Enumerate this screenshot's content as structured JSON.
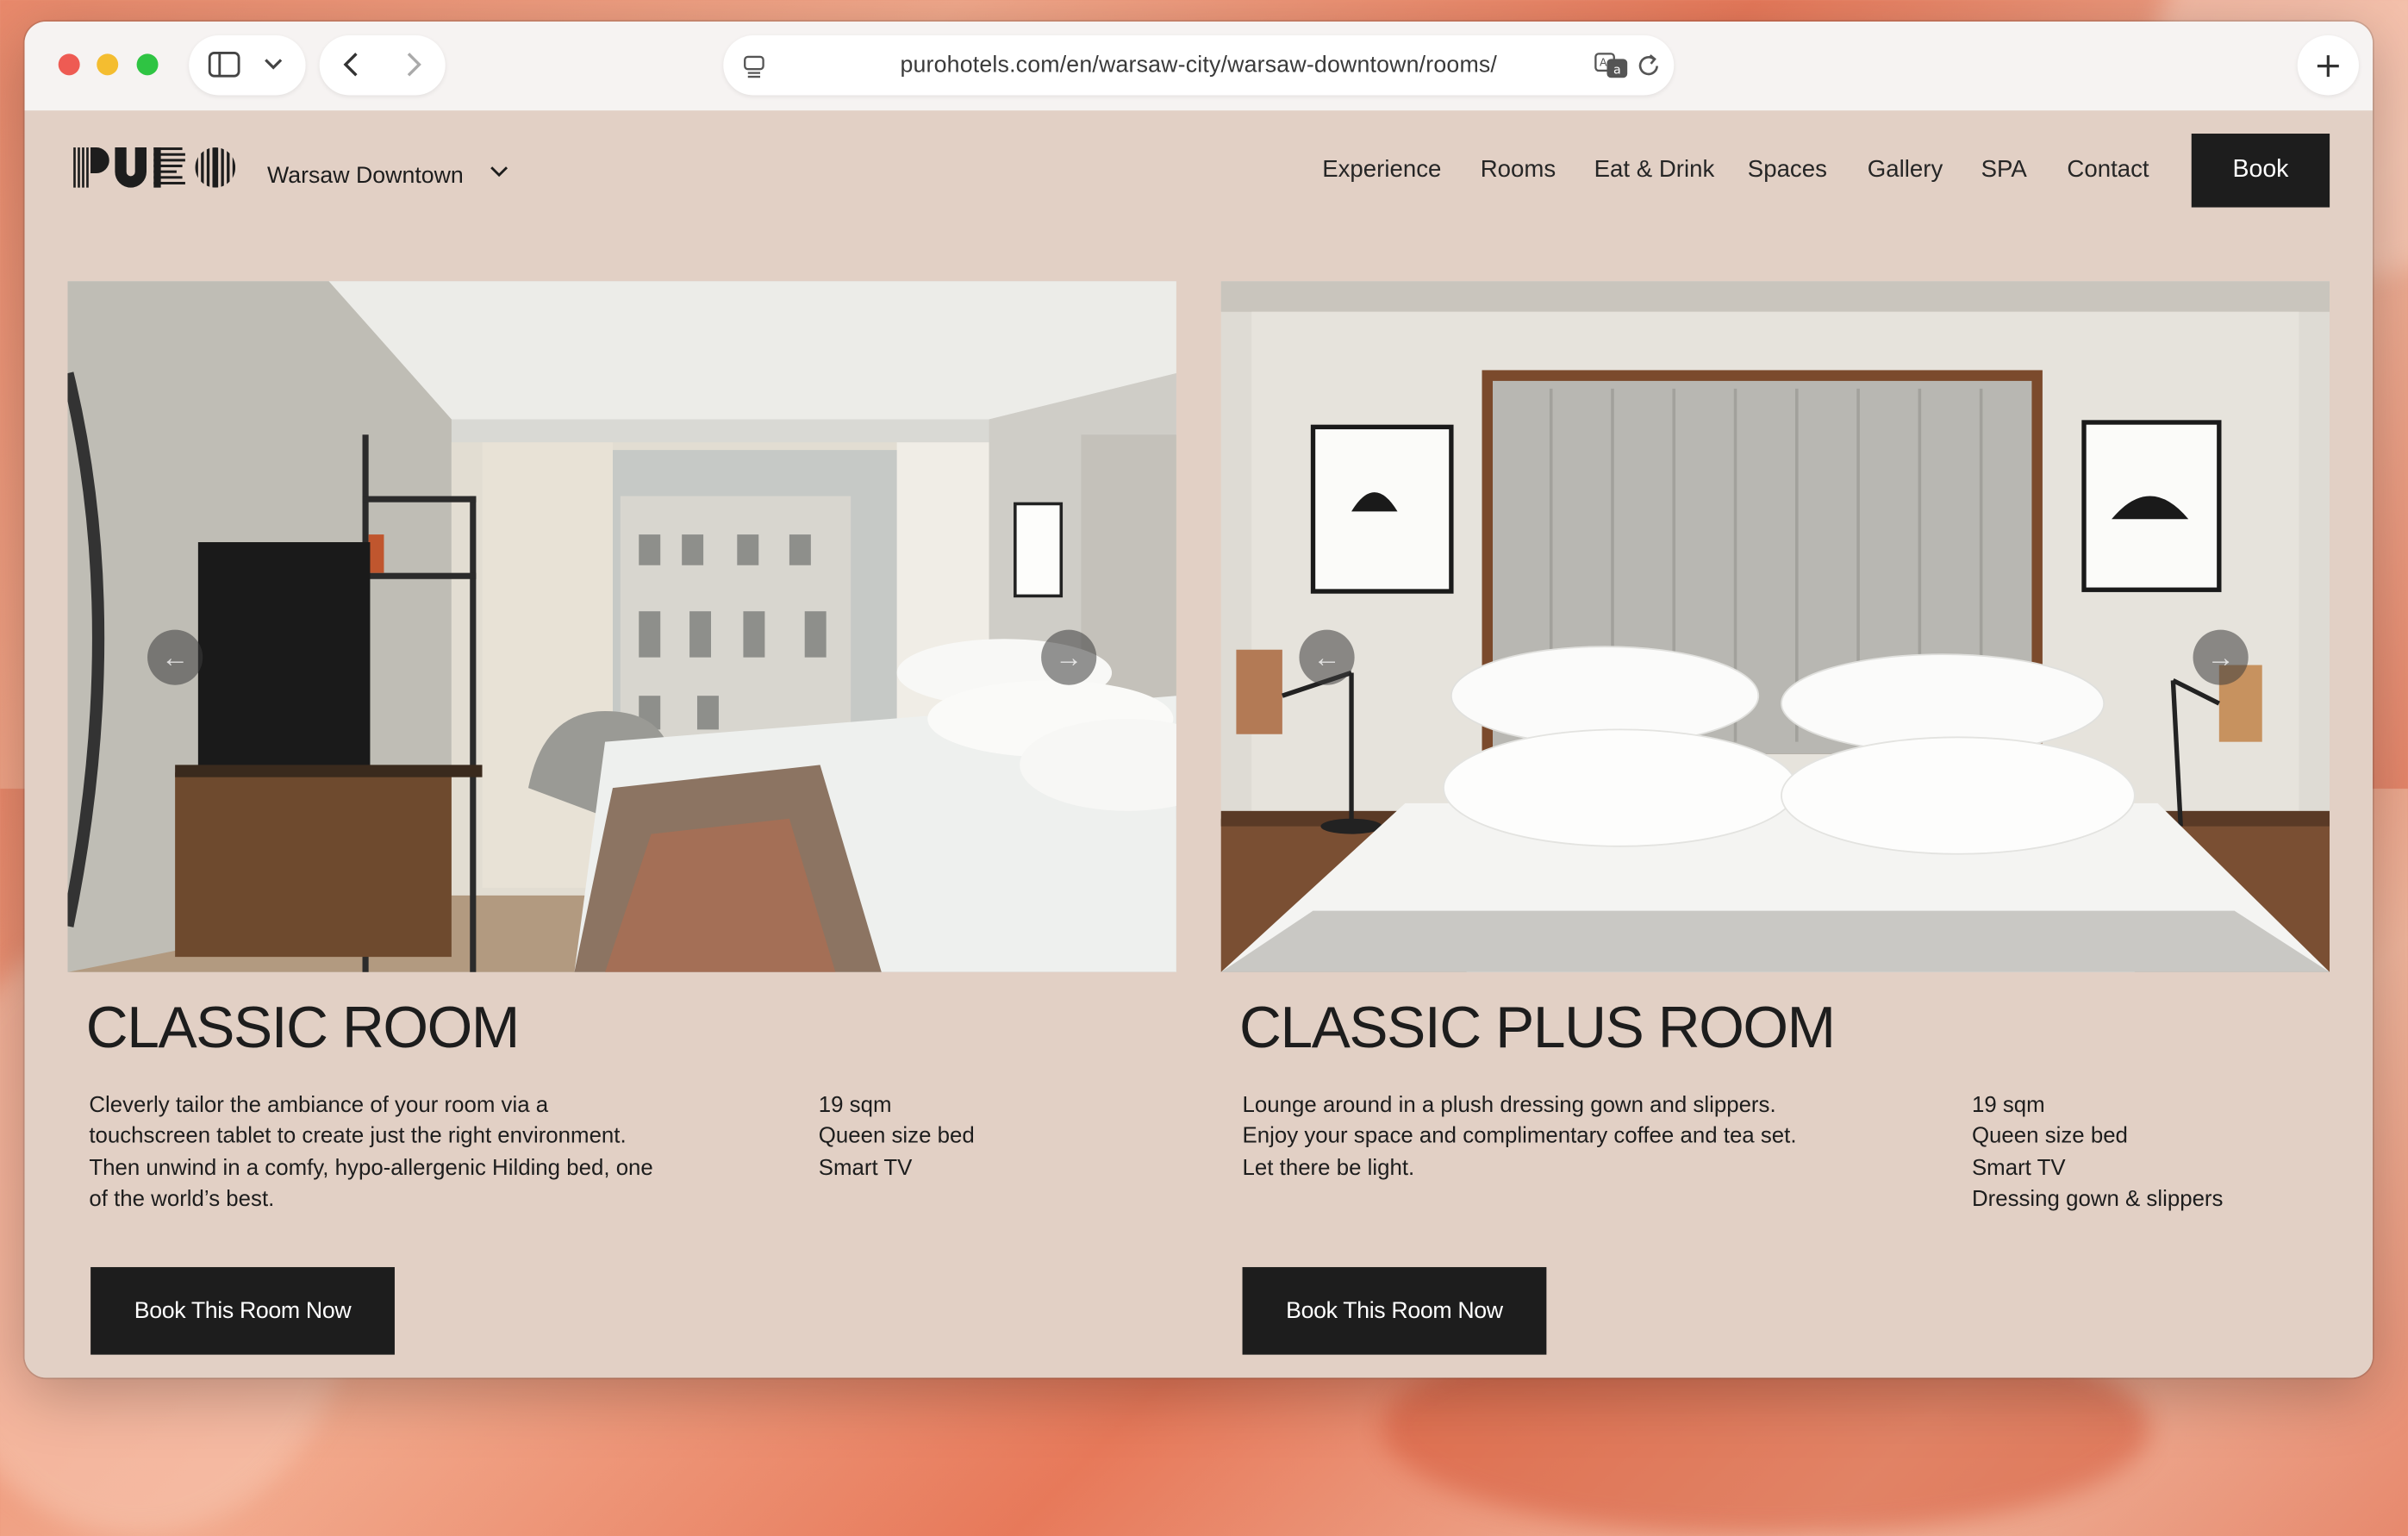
{
  "browser": {
    "url": "purohotels.com/en/warsaw-city/warsaw-downtown/rooms/"
  },
  "header": {
    "logo_text": "PURO",
    "location": "Warsaw Downtown",
    "nav": [
      "Experience",
      "Rooms",
      "Eat & Drink",
      "Spaces",
      "Gallery",
      "SPA",
      "Contact"
    ],
    "book_label": "Book"
  },
  "rooms": [
    {
      "title": "CLASSIC ROOM",
      "description": "Cleverly tailor the ambiance of your room via a touchscreen tablet to create just the right environment. Then unwind in a comfy, hypo-allergenic Hilding bed, one of the world’s best.",
      "features": [
        "19 sqm",
        "Queen size bed",
        "Smart TV"
      ],
      "cta": "Book This Room Now"
    },
    {
      "title": "CLASSIC PLUS ROOM",
      "description": "Lounge around in a plush dressing gown and slippers. Enjoy your space and complimentary coffee and tea set. Let there be light.",
      "features": [
        "19 sqm",
        "Queen size bed",
        "Smart TV",
        "Dressing gown & slippers"
      ],
      "cta": "Book This Room Now"
    }
  ],
  "colors": {
    "page_background": "#e2d0c5",
    "button_dark": "#1d1d1d",
    "text": "#1d1d1d"
  },
  "icons": [
    "sidebar-icon",
    "chevron-down-icon",
    "back-arrow-icon",
    "forward-arrow-icon",
    "reader-icon",
    "translate-icon",
    "reload-icon",
    "plus-icon",
    "arrow-left-icon",
    "arrow-right-icon"
  ]
}
